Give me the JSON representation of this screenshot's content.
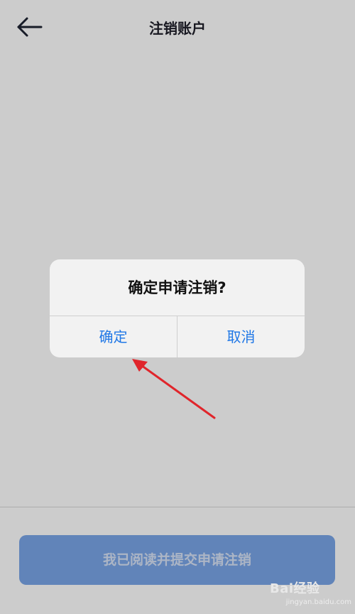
{
  "header": {
    "title": "注销账户",
    "back_icon": "arrow-left-icon"
  },
  "dialog": {
    "title": "确定申请注销?",
    "confirm_label": "确定",
    "cancel_label": "取消",
    "button_color": "#1f77e6"
  },
  "submit": {
    "label": "我已阅读并提交申请注销",
    "color": "#7aa6e8"
  },
  "annotation": {
    "arrow_color": "#e0252b"
  },
  "watermark": {
    "brand": "Bai经验",
    "url": "jingyan.baidu.com"
  }
}
